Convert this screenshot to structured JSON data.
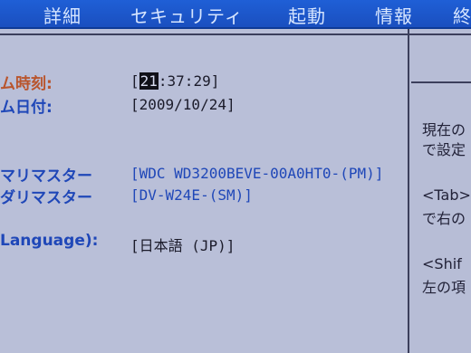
{
  "menubar": {
    "items": [
      "詳細",
      "セキュリティ",
      "起動",
      "情報",
      "終"
    ]
  },
  "fields": {
    "time_label": "ム時刻:",
    "time_cursor": "21",
    "time_rest": ":37:29]",
    "time_open": "[",
    "date_label": "ム日付:",
    "date_value": "[2009/10/24]",
    "primary_master_label": "マリマスター",
    "primary_master_value": "[WDC WD3200BEVE-00A0HT0-(PM)]",
    "secondary_master_label": "ダリマスター",
    "secondary_master_value": "[DV-W24E-(SM)]",
    "language_label": "Language):",
    "language_value": "[日本語   (JP)]"
  },
  "help": {
    "line1": "現在の",
    "line2": "で設定",
    "line3": "<Tab>",
    "line4": "で右の",
    "line5": "<Shif",
    "line6": "左の項"
  }
}
